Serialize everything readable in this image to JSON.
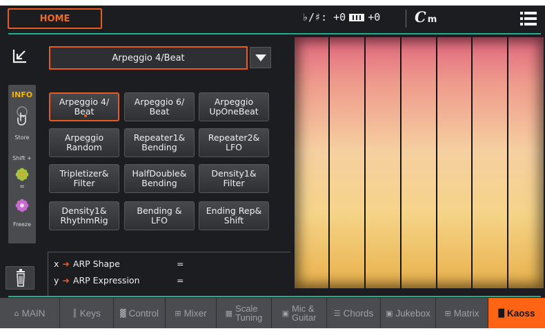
{
  "top_bar": {
    "home_label": "HOME",
    "transpose_text": "♭/♯: +0",
    "keyboard_transpose_text": "+0",
    "chord_root": "C",
    "chord_quality": "m"
  },
  "preset": {
    "selected": "Arpeggio 4/Beat"
  },
  "side_strip": {
    "info": "INFO",
    "store": "Store",
    "shift": "Shift +",
    "equals": "=",
    "freeze": "Freeze"
  },
  "presets": [
    {
      "label": "Arpeggio 4/\nBeat",
      "selected": true
    },
    {
      "label": "Arpeggio 6/\nBeat",
      "selected": false
    },
    {
      "label": "Arpeggio\nUpOneBeat",
      "selected": false
    },
    {
      "label": "Arpeggio\nRandom",
      "selected": false
    },
    {
      "label": "Repeater1&\nBending",
      "selected": false
    },
    {
      "label": "Repeater2&\nLFO",
      "selected": false
    },
    {
      "label": "Tripletizer&\nFilter",
      "selected": false
    },
    {
      "label": "HalfDouble&\nBending",
      "selected": false
    },
    {
      "label": "Density1&\nFilter",
      "selected": false
    },
    {
      "label": "Density1&\nRhythmRig",
      "selected": false
    },
    {
      "label": "Bending &\nLFO",
      "selected": false
    },
    {
      "label": "Ending Rep&\nShift",
      "selected": false
    }
  ],
  "xy": {
    "x_axis": "x",
    "x_label": "ARP Shape",
    "x_value": "=",
    "y_axis": "y",
    "y_label": "ARP Expression",
    "y_value": "="
  },
  "tabs": [
    {
      "icon": "home-icon",
      "glyph": "⌂",
      "label": "MAIN"
    },
    {
      "icon": "keys-icon",
      "glyph": "║",
      "label": "Keys"
    },
    {
      "icon": "control-icon",
      "glyph": "▓",
      "label": "Control"
    },
    {
      "icon": "mixer-icon",
      "glyph": "⊞",
      "label": "Mixer"
    },
    {
      "icon": "scale-icon",
      "glyph": "▦",
      "label": "Scale",
      "label2": "Tuning"
    },
    {
      "icon": "mic-icon",
      "glyph": "▣",
      "label": "Mic &",
      "label2": "Guitar"
    },
    {
      "icon": "chords-icon",
      "glyph": "☰",
      "label": "Chords"
    },
    {
      "icon": "jukebox-icon",
      "glyph": "▣",
      "label": "Jukebox"
    },
    {
      "icon": "matrix-icon",
      "glyph": "⊞",
      "label": "Matrix"
    },
    {
      "icon": "kaoss-icon",
      "glyph": "█",
      "label": "Kaoss",
      "active": true
    }
  ],
  "colors": {
    "accent": "#e85a1e",
    "active_tab": "#ff6414",
    "divider": "#20b08c",
    "info": "#f3b400"
  }
}
